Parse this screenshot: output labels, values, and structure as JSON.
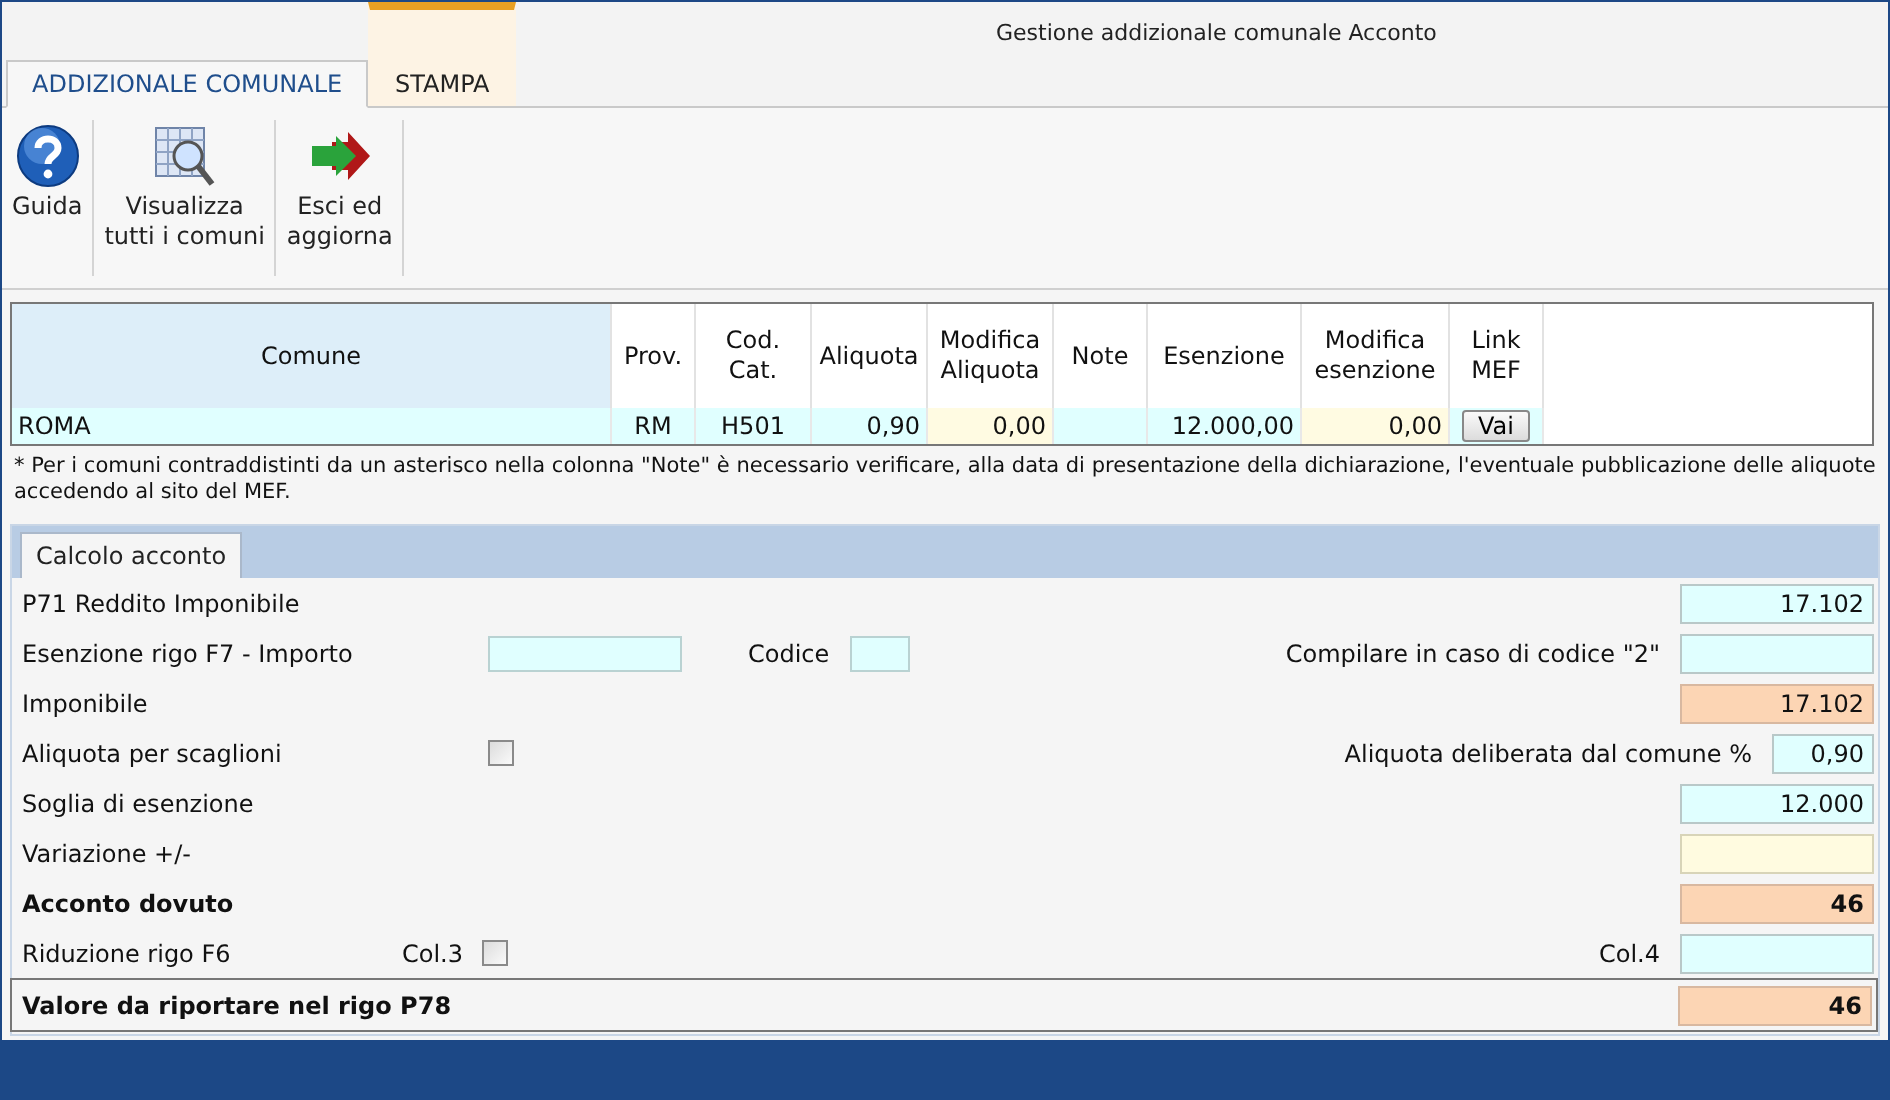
{
  "window": {
    "title": "Gestione addizionale comunale Acconto"
  },
  "tabs": [
    {
      "label": "ADDIZIONALE COMUNALE",
      "selected": true,
      "kind": "main"
    },
    {
      "label": "STAMPA",
      "selected": false,
      "kind": "contextual"
    }
  ],
  "toolbar": {
    "buttons": [
      {
        "label": "Guida",
        "kind": "help"
      },
      {
        "label": "Visualizza\ntutti i comuni",
        "kind": "grid"
      },
      {
        "label": "Esci ed\naggiorna",
        "kind": "exit"
      }
    ]
  },
  "table": {
    "columns": [
      {
        "label": "Comune",
        "selected": true,
        "editable": false,
        "kind": "name"
      },
      {
        "label": "Prov.",
        "selected": false,
        "editable": false,
        "kind": "text"
      },
      {
        "label": "Cod.\nCat.",
        "selected": false,
        "editable": false,
        "kind": "text"
      },
      {
        "label": "Aliquota",
        "selected": false,
        "editable": false,
        "kind": "number"
      },
      {
        "label": "Modifica\nAliquota",
        "selected": false,
        "editable": true,
        "kind": "number"
      },
      {
        "label": "Note",
        "selected": false,
        "editable": false,
        "kind": "text"
      },
      {
        "label": "Esenzione",
        "selected": false,
        "editable": false,
        "kind": "number"
      },
      {
        "label": "Modifica\nesenzione",
        "selected": false,
        "editable": true,
        "kind": "number"
      },
      {
        "label": "Link\nMEF",
        "selected": false,
        "editable": false,
        "kind": "button"
      }
    ],
    "rows": [
      {
        "cells": [
          "ROMA",
          "RM",
          "H501",
          "0,90",
          "0,00",
          null,
          "12.000,00",
          "0,00",
          "Vai"
        ]
      }
    ]
  },
  "note": "* Per i comuni contraddistinti da un asterisco nella colonna \"Note\" è necessario verificare,  alla data di presentazione della dichiarazione, l'eventuale pubblicazione delle aliquote accedendo al sito del MEF.",
  "panel": {
    "tab": {
      "label": "Calcolo acconto",
      "selected": true
    },
    "rows": [
      {
        "label": "P71 Reddito Imponibile",
        "value": "17.102",
        "kind": "input"
      },
      {
        "label": "Esenzione rigo F7 -  Importo",
        "inline": [
          {
            "kind": "amount"
          },
          {
            "kind": "label",
            "text": "Codice"
          },
          {
            "kind": "code"
          }
        ],
        "right_label": "Compilare in caso di codice \"2\"",
        "kind": "input"
      },
      {
        "label": "Imponibile",
        "value": "17.102",
        "kind": "computed"
      },
      {
        "label": "Aliquota per scaglioni",
        "inline": [
          {
            "kind": "checkbox",
            "checked": false
          }
        ],
        "right_label": "Aliquota deliberata dal comune %",
        "value": "0,90",
        "kind": "rate"
      },
      {
        "label": "Soglia di esenzione",
        "value": "12.000",
        "kind": "input"
      },
      {
        "label": "Variazione +/-",
        "kind": "editable"
      },
      {
        "label": "Acconto dovuto",
        "bold": true,
        "value": "46",
        "kind": "computed"
      },
      {
        "label": "Riduzione rigo F6",
        "inline": [
          {
            "kind": "label",
            "text": "Col.3"
          },
          {
            "kind": "checkbox",
            "checked": false
          }
        ],
        "right_label": "Col.4",
        "kind": "input"
      },
      {
        "label": "Valore da riportare nel rigo P78",
        "bold": true,
        "boxed": true,
        "value": "46",
        "kind": "computed"
      }
    ]
  }
}
